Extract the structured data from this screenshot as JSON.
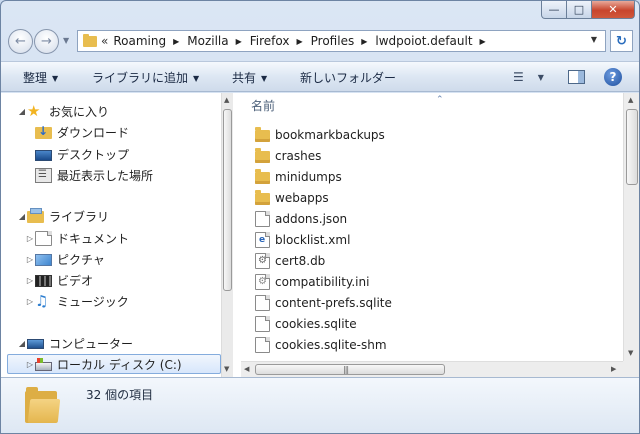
{
  "window": {
    "caption_buttons": {
      "minimize": "—",
      "maximize": "□",
      "close": "✕"
    }
  },
  "address_bar": {
    "lead": "«",
    "crumbs": [
      "Roaming",
      "Mozilla",
      "Firefox",
      "Profiles",
      "lwdpoiot.default"
    ]
  },
  "toolbar": {
    "organize": "整理",
    "add_to_library": "ライブラリに追加",
    "share": "共有",
    "new_folder": "新しいフォルダー"
  },
  "nav_tree": {
    "favorites": {
      "label": "お気に入り",
      "items": [
        "ダウンロード",
        "デスクトップ",
        "最近表示した場所"
      ]
    },
    "libraries": {
      "label": "ライブラリ",
      "items": [
        "ドキュメント",
        "ピクチャ",
        "ビデオ",
        "ミュージック"
      ]
    },
    "computer": {
      "label": "コンピューター",
      "items": [
        "ローカル ディスク (C:)"
      ]
    }
  },
  "file_list": {
    "column_name": "名前",
    "items": [
      {
        "name": "bookmarkbackups",
        "icon": "folder-icon"
      },
      {
        "name": "crashes",
        "icon": "folder-icon"
      },
      {
        "name": "minidumps",
        "icon": "folder-icon"
      },
      {
        "name": "webapps",
        "icon": "folder-icon"
      },
      {
        "name": "addons.json",
        "icon": "document-icon"
      },
      {
        "name": "blocklist.xml",
        "icon": "xml-file-icon"
      },
      {
        "name": "cert8.db",
        "icon": "db-file-icon"
      },
      {
        "name": "compatibility.ini",
        "icon": "ini-file-icon"
      },
      {
        "name": "content-prefs.sqlite",
        "icon": "document-icon"
      },
      {
        "name": "cookies.sqlite",
        "icon": "document-icon"
      },
      {
        "name": "cookies.sqlite-shm",
        "icon": "document-icon"
      }
    ]
  },
  "details_pane": {
    "item_count_text": "32 個の項目"
  },
  "colors": {
    "chrome": "#dbe6f4",
    "selection": "#d7e6fb",
    "close_button": "#c8452d",
    "folder": "#e8bd4f"
  }
}
